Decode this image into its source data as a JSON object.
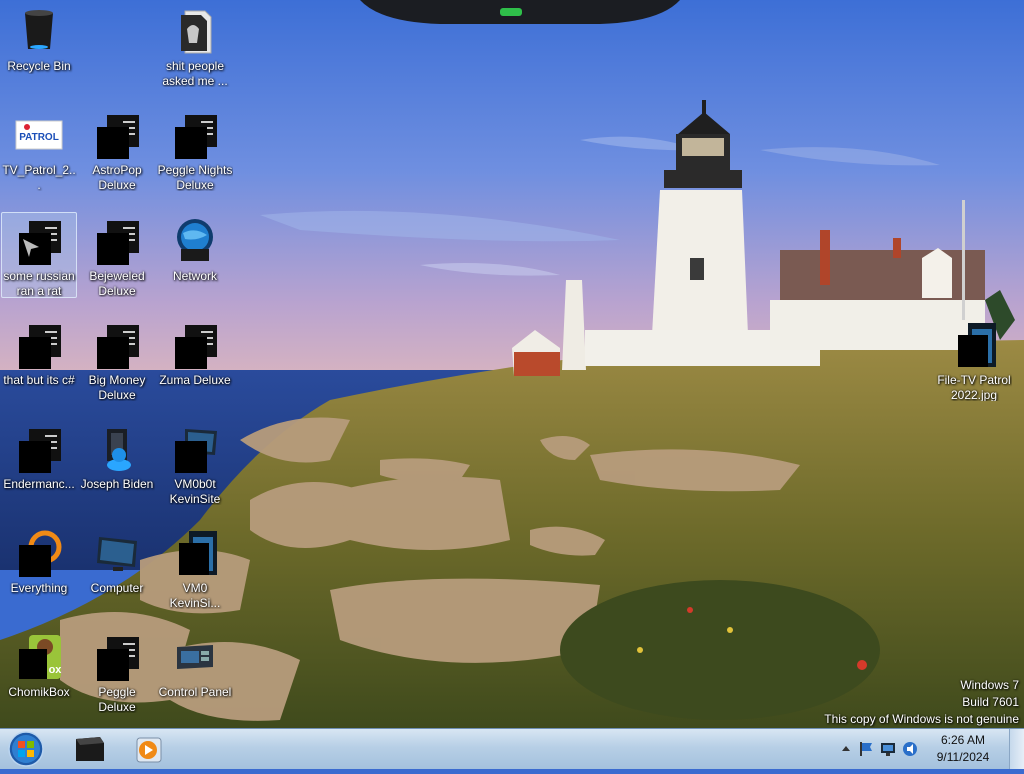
{
  "desktop_icons": [
    {
      "label": "Recycle Bin",
      "icon": "recycle-bin-icon"
    },
    {
      "label": "shit people asked me ...",
      "icon": "folder-icon"
    },
    {
      "label": "TV_Patrol_2...",
      "icon": "image-file-icon",
      "logo_text": "PATROL"
    },
    {
      "label": "AstroPop Deluxe",
      "icon": "application-icon"
    },
    {
      "label": "Peggle Nights Deluxe",
      "icon": "application-icon"
    },
    {
      "label": "some russian ran a rat",
      "icon": "application-shortcut-icon"
    },
    {
      "label": "Bejeweled Deluxe",
      "icon": "application-icon"
    },
    {
      "label": "Network",
      "icon": "network-globe-icon"
    },
    {
      "label": "that but its c#",
      "icon": "application-icon"
    },
    {
      "label": "Big Money Deluxe",
      "icon": "application-icon"
    },
    {
      "label": "Zuma Deluxe",
      "icon": "application-icon"
    },
    {
      "label": "Endermanc...",
      "icon": "application-icon"
    },
    {
      "label": "Joseph Biden",
      "icon": "user-figure-icon"
    },
    {
      "label": "VM0b0t KevinSite",
      "icon": "monitor-shortcut-icon"
    },
    {
      "label": "Everything",
      "icon": "everything-search-icon"
    },
    {
      "label": "Computer",
      "icon": "computer-monitor-icon"
    },
    {
      "label": "VM0 KevinSi...",
      "icon": "window-file-icon"
    },
    {
      "label": "ChomikBox",
      "icon": "chomikbox-icon",
      "logo_text": "ox"
    },
    {
      "label": "Peggle Deluxe",
      "icon": "application-icon"
    },
    {
      "label": "Control Panel",
      "icon": "control-panel-icon"
    },
    {
      "label": "File-TV Patrol 2022.jpg",
      "icon": "window-file-icon"
    }
  ],
  "watermark": {
    "line1": "Windows 7",
    "line2": "Build 7601",
    "line3": "This copy of Windows is not genuine"
  },
  "taskbar": {
    "start_icon": "windows-orb-icon",
    "pinned": [
      "terminal-box-icon",
      "media-player-icon"
    ],
    "tray_icons": [
      "show-hidden-icons-arrow",
      "flag-action-center-icon",
      "network-monitor-icon",
      "volume-icon"
    ],
    "clock_time": "6:26 AM",
    "clock_date": "9/11/2024"
  },
  "colors": {
    "sky_top": "#3d6fd6",
    "sea": "#1f3f8a",
    "taskbar": "#b7cfe6",
    "label_text": "#ffffff"
  }
}
